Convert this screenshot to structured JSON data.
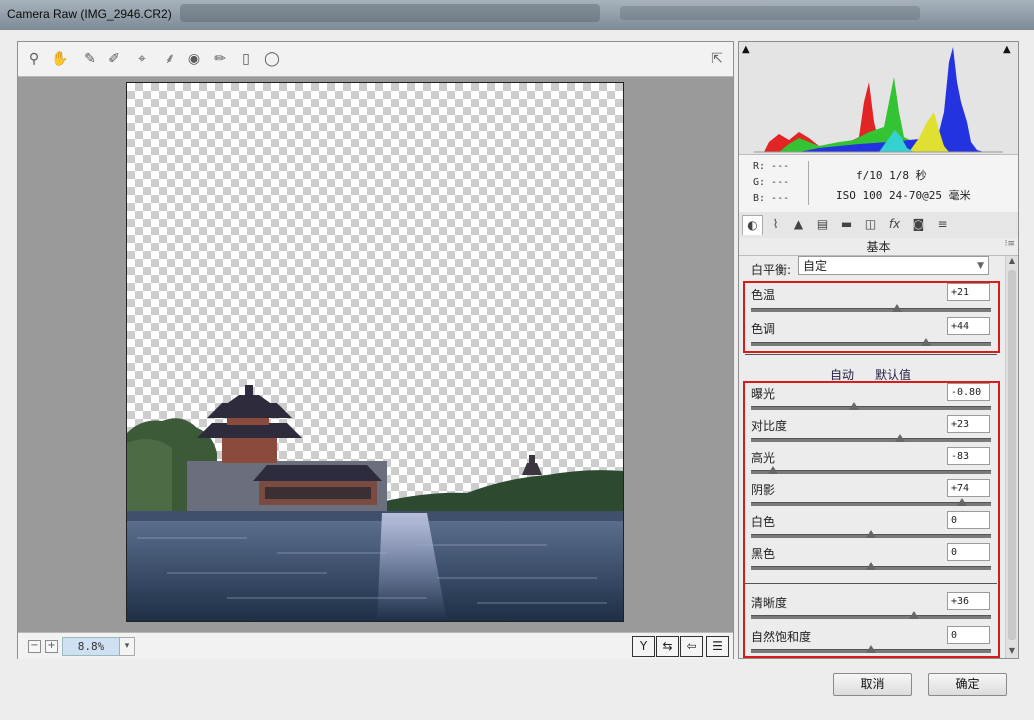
{
  "window": {
    "title": "Camera Raw (IMG_2946.CR2)"
  },
  "toolbar": {
    "tools": [
      {
        "name": "zoom-tool",
        "icon": "magnifier-icon",
        "glyph": "⚲"
      },
      {
        "name": "hand-tool",
        "icon": "hand-icon",
        "glyph": "✋"
      },
      {
        "name": "white-balance-tool",
        "icon": "eyedropper-icon",
        "glyph": "✎"
      },
      {
        "name": "color-sampler-tool",
        "icon": "color-sampler-icon",
        "glyph": "✐"
      },
      {
        "name": "targeted-adjustment-tool",
        "icon": "target-adjust-icon",
        "glyph": "⌖"
      },
      {
        "name": "spot-removal-tool",
        "icon": "spot-brush-icon",
        "glyph": "⸙"
      },
      {
        "name": "red-eye-tool",
        "icon": "red-eye-icon",
        "glyph": "◉"
      },
      {
        "name": "adjustment-brush-tool",
        "icon": "brush-icon",
        "glyph": "✏"
      },
      {
        "name": "graduated-filter-tool",
        "icon": "graduated-filter-icon",
        "glyph": "▯"
      },
      {
        "name": "radial-filter-tool",
        "icon": "radial-filter-icon",
        "glyph": "◯"
      }
    ],
    "fullscreen_icon": "fullscreen-icon"
  },
  "statusbar": {
    "zoom_minus": "−",
    "zoom_plus": "+",
    "zoom": "8.8%",
    "zoom_dropdown": "▾",
    "view_buttons": [
      "Y",
      "⇆",
      "⇦",
      "☰"
    ]
  },
  "histogram": {
    "clip_shadow": "▲",
    "clip_highlight": "▲"
  },
  "info": {
    "r": "R:  ---",
    "g": "G:  ---",
    "b": "B:  ---",
    "aperture_shutter": "f/10   1/8 秒",
    "iso_lens": "ISO 100   24-70@25 毫米"
  },
  "panel_tabs": [
    "basic-icon",
    "tone-curve-icon",
    "detail-icon",
    "hsl-icon",
    "split-toning-icon",
    "lens-icon",
    "fx-icon",
    "camera-calibration-icon",
    "presets-icon"
  ],
  "panel_tab_glyphs": [
    "◐",
    "⌇",
    "▲",
    "▤",
    "▬",
    "◫",
    "fx",
    "◙",
    "≡"
  ],
  "basic": {
    "title": "基本",
    "menu_glyph": "⁝≡",
    "white_balance_label": "白平衡:",
    "white_balance_value": "自定",
    "temp": {
      "label": "色温",
      "value": "+21",
      "pos": 0.61
    },
    "tint": {
      "label": "色调",
      "value": "+44",
      "pos": 0.73
    },
    "auto_label": "自动",
    "default_label": "默认值",
    "exposure": {
      "label": "曝光",
      "value": "-0.80",
      "pos": 0.43
    },
    "contrast": {
      "label": "对比度",
      "value": "+23",
      "pos": 0.62
    },
    "highlights": {
      "label": "高光",
      "value": "-83",
      "pos": 0.09
    },
    "shadows": {
      "label": "阴影",
      "value": "+74",
      "pos": 0.88
    },
    "whites": {
      "label": "白色",
      "value": "0",
      "pos": 0.5
    },
    "blacks": {
      "label": "黑色",
      "value": "0",
      "pos": 0.5
    },
    "clarity": {
      "label": "清晰度",
      "value": "+36",
      "pos": 0.68
    },
    "vibrance": {
      "label": "自然饱和度",
      "value": "0",
      "pos": 0.5
    }
  },
  "buttons": {
    "cancel": "取消",
    "ok": "确定"
  }
}
